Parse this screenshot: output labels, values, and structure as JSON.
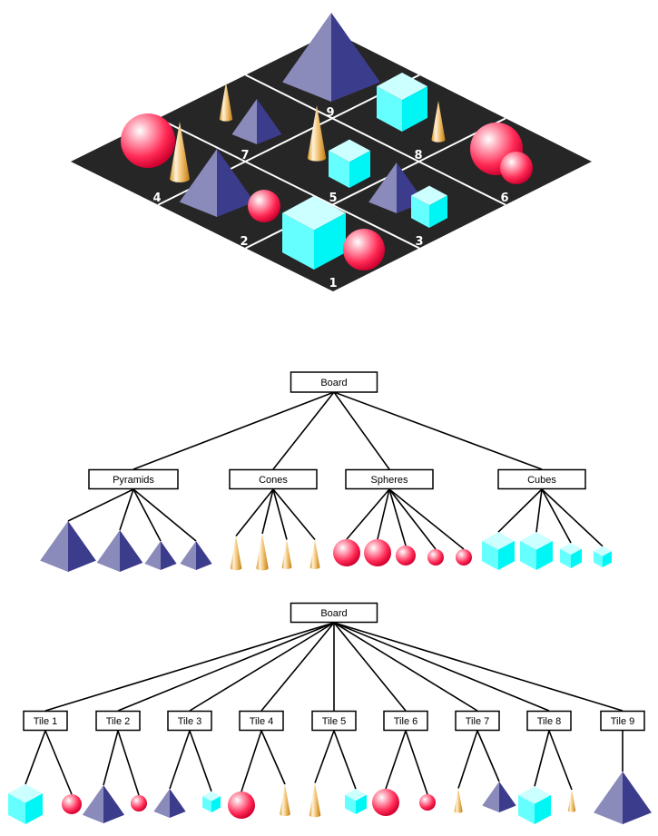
{
  "colors": {
    "board": "#262626",
    "grid": "#ffffff",
    "pyramid_light": "#8a8abb",
    "pyramid_dark": "#3c3c8c",
    "cube_top": "#ccffff",
    "cube_left": "#66ffff",
    "cube_right": "#00f5f5",
    "sphere_base": "#ff2050",
    "cone_base": "#e0a030"
  },
  "board_scene": {
    "tiles": [
      {
        "label": "1",
        "objects": [
          "cube",
          "sphere"
        ]
      },
      {
        "label": "2",
        "objects": [
          "pyramid",
          "sphere"
        ]
      },
      {
        "label": "3",
        "objects": [
          "pyramid",
          "cube"
        ]
      },
      {
        "label": "4",
        "objects": [
          "sphere",
          "cone"
        ]
      },
      {
        "label": "5",
        "objects": [
          "cone",
          "cube"
        ]
      },
      {
        "label": "6",
        "objects": [
          "sphere",
          "sphere"
        ]
      },
      {
        "label": "7",
        "objects": [
          "cone",
          "pyramid"
        ]
      },
      {
        "label": "8",
        "objects": [
          "cube",
          "cone"
        ]
      },
      {
        "label": "9",
        "objects": [
          "pyramid"
        ]
      }
    ]
  },
  "tree_by_shape": {
    "root": "Board",
    "groups": [
      {
        "label": "Pyramids",
        "shape": "pyramid",
        "children": 4
      },
      {
        "label": "Cones",
        "shape": "cone",
        "children": 4
      },
      {
        "label": "Spheres",
        "shape": "sphere",
        "children": 5
      },
      {
        "label": "Cubes",
        "shape": "cube",
        "children": 4
      }
    ]
  },
  "tree_by_tile": {
    "root": "Board",
    "groups": [
      {
        "label": "Tile 1",
        "children": [
          "cube",
          "sphere"
        ]
      },
      {
        "label": "Tile 2",
        "children": [
          "pyramid",
          "sphere"
        ]
      },
      {
        "label": "Tile 3",
        "children": [
          "pyramid",
          "cube"
        ]
      },
      {
        "label": "Tile 4",
        "children": [
          "sphere",
          "cone"
        ]
      },
      {
        "label": "Tile 5",
        "children": [
          "cone",
          "cube"
        ]
      },
      {
        "label": "Tile 6",
        "children": [
          "sphere",
          "sphere"
        ]
      },
      {
        "label": "Tile 7",
        "children": [
          "cone",
          "pyramid"
        ]
      },
      {
        "label": "Tile 8",
        "children": [
          "cube",
          "cone"
        ]
      },
      {
        "label": "Tile 9",
        "children": [
          "pyramid"
        ]
      }
    ]
  }
}
